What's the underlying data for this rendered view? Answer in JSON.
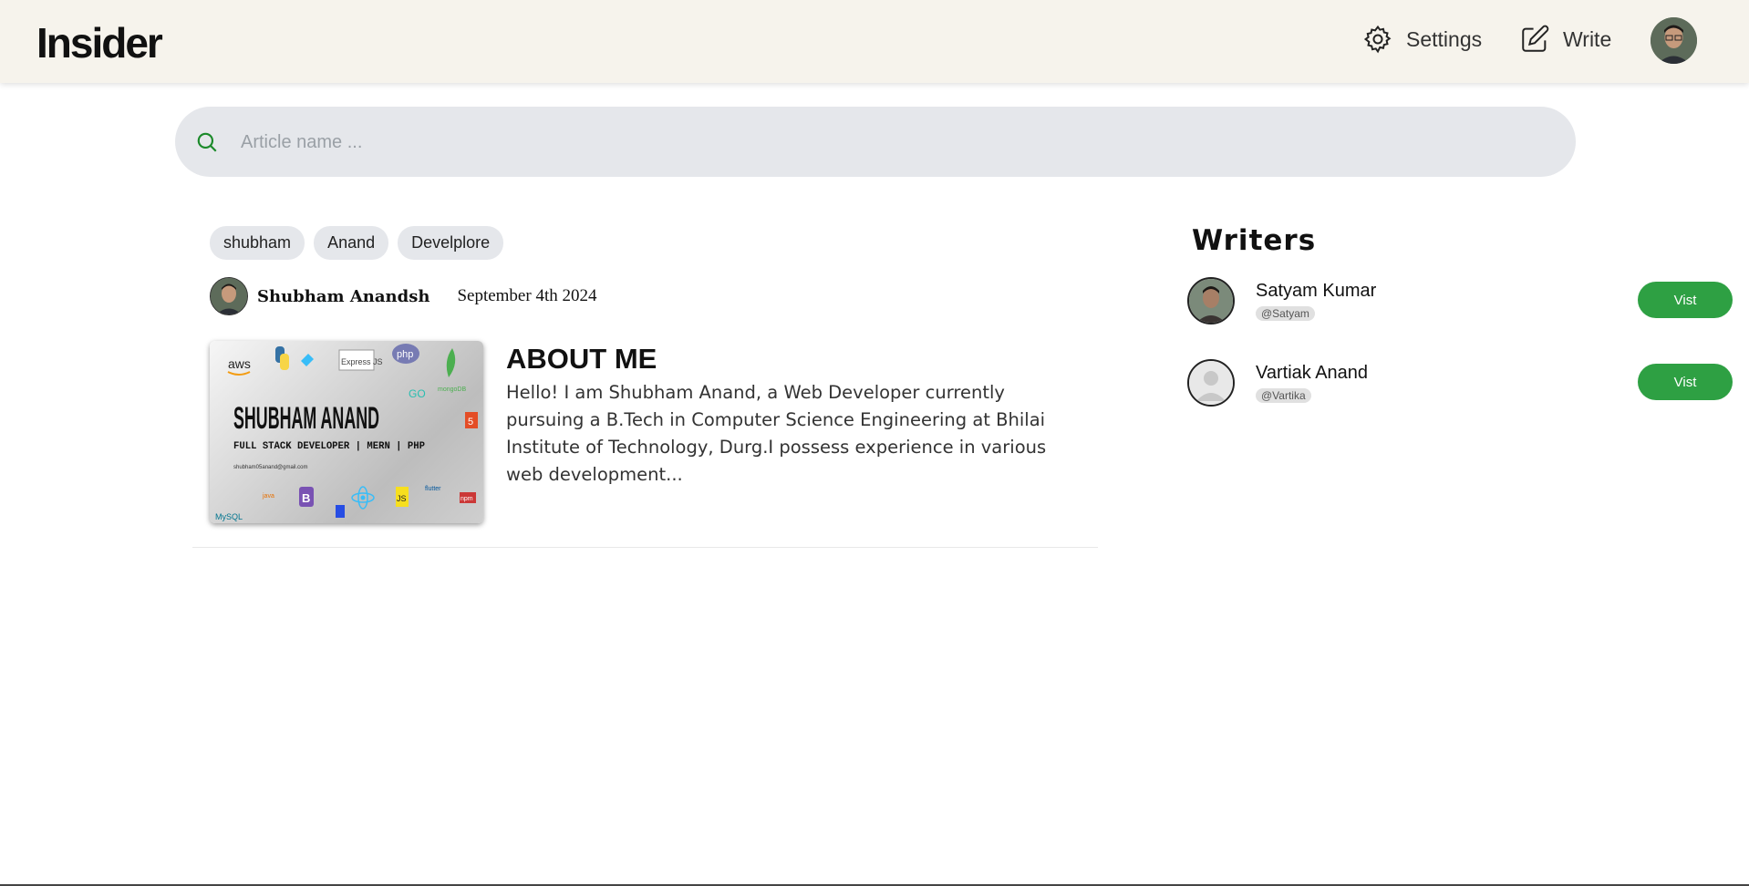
{
  "header": {
    "logo": "Insider",
    "settings_label": "Settings",
    "write_label": "Write"
  },
  "search": {
    "placeholder": "Article name ..."
  },
  "article": {
    "tags": [
      "shubham",
      "Anand",
      "Develplore"
    ],
    "author": "Shubham Anandsh",
    "date": "September 4th 2024",
    "title": "ABOUT ME",
    "excerpt": "Hello! I am Shubham Anand, a Web Developer currently pursuing a B.Tech in Computer Science Engineering at Bhilai Institute of Technology, Durg.I possess experience in various web development...",
    "thumbnail": {
      "name": "SHUBHAM ANAND",
      "subtitle": "FULL STACK DEVELOPER | MERN | PHP",
      "email": "shubham05anand@gmail.com",
      "logos": [
        "aws",
        "Express JS",
        "php",
        "GO",
        "mongoDB",
        "5",
        "B",
        "JS",
        "npm",
        "MySQL",
        "java",
        "flutter"
      ]
    }
  },
  "writers": {
    "title": "Writers",
    "list": [
      {
        "name": "Satyam Kumar",
        "handle": "@Satyam",
        "button": "Vist"
      },
      {
        "name": "Vartiak Anand",
        "handle": "@Vartika",
        "button": "Vist"
      }
    ]
  },
  "colors": {
    "header_bg": "#f6f3ec",
    "search_bg": "#e5e7eb",
    "accent_green": "#2ea043"
  }
}
